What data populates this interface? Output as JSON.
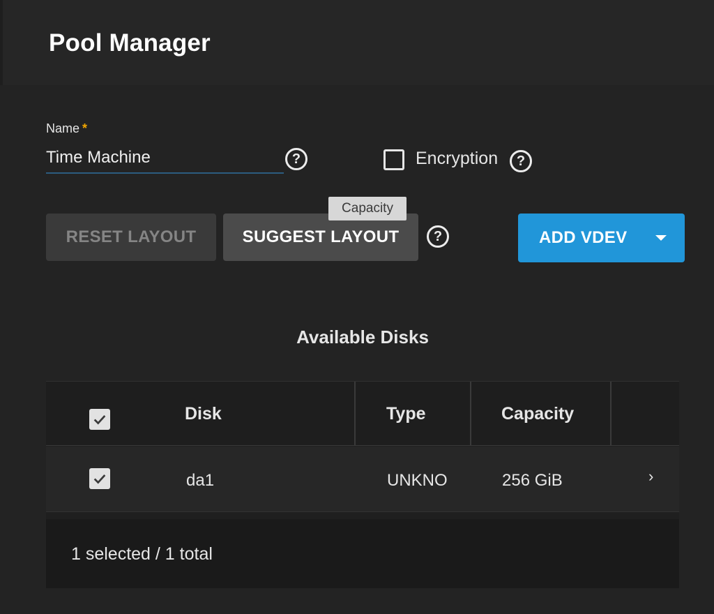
{
  "header": {
    "title": "Pool Manager"
  },
  "form": {
    "name_label": "Name",
    "required_marker": "*",
    "name_value": "Time Machine",
    "encryption_label": "Encryption",
    "encryption_checked": false
  },
  "icons": {
    "help": "question-circle-icon",
    "help_glyph": "?",
    "checkbox_checked": "check-icon",
    "row_expand": "chevron-right-icon",
    "row_expand_glyph": "›",
    "dropdown": "caret-down-icon"
  },
  "buttons": {
    "reset_layout": "RESET LAYOUT",
    "suggest_layout": "SUGGEST LAYOUT",
    "add_vdev": "ADD VDEV"
  },
  "tooltip": {
    "text": "Capacity"
  },
  "disks": {
    "section_title": "Available Disks",
    "columns": [
      "Disk",
      "Type",
      "Capacity"
    ],
    "rows": [
      {
        "disk": "da1",
        "type": "UNKNO",
        "capacity": "256 GiB",
        "selected": true
      }
    ],
    "footer": "1 selected / 1 total"
  },
  "colors": {
    "accent": "#2196d9",
    "required": "#f0a500",
    "background": "#232323"
  }
}
